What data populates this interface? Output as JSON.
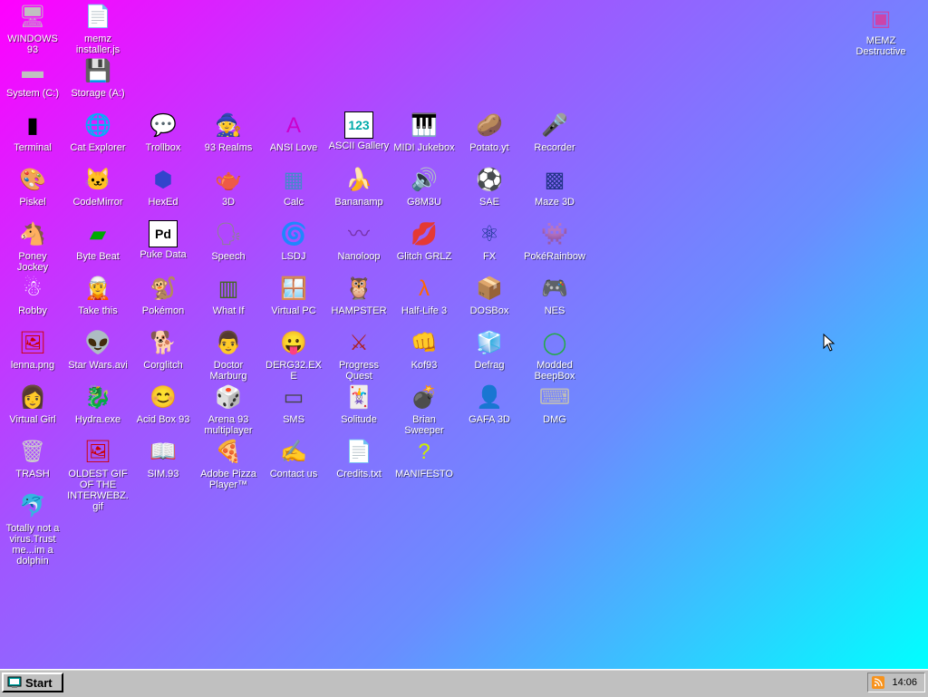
{
  "desktop": {
    "icons": [
      {
        "name": "windows93-icon-item",
        "label": "WINDOWS 93",
        "glyph": "🖥",
        "color": "#c0c0c0"
      },
      {
        "name": "memz-installer-icon-item",
        "label": "memz installer.js",
        "glyph": "📄",
        "color": "#ffd800"
      },
      {
        "name": "system-c-icon-item",
        "label": "System (C:)",
        "glyph": "▬",
        "color": "#c0c0c0"
      },
      {
        "name": "storage-a-icon-item",
        "label": "Storage (A:)",
        "glyph": "💾",
        "color": "#c0c0c0"
      },
      {
        "name": "terminal-icon-item",
        "label": "Terminal",
        "glyph": "▮",
        "color": "#000000"
      },
      {
        "name": "cat-explorer-icon-item",
        "label": "Cat Explorer",
        "glyph": "🌐",
        "color": "#3399ff"
      },
      {
        "name": "trollbox-icon-item",
        "label": "Trollbox",
        "glyph": "💬",
        "color": "#66ccff"
      },
      {
        "name": "93-realms-icon-item",
        "label": "93 Realms",
        "glyph": "🧙",
        "color": "#cc0000"
      },
      {
        "name": "ansi-love-icon-item",
        "label": "ANSI Love",
        "glyph": "A",
        "color": "#cc00cc"
      },
      {
        "name": "ascii-gallery-icon-item",
        "label": "ASCII Gallery",
        "glyph": "123",
        "color": "#00aaaa"
      },
      {
        "name": "midi-jukebox-icon-item",
        "label": "MIDI Jukebox",
        "glyph": "🎹",
        "color": "#000000"
      },
      {
        "name": "potato-yt-icon-item",
        "label": "Potato.yt",
        "glyph": "🥔",
        "color": "#a0703a"
      },
      {
        "name": "recorder-icon-item",
        "label": "Recorder",
        "glyph": "🎤",
        "color": "#888888"
      },
      {
        "name": "piskel-icon-item",
        "label": "Piskel",
        "glyph": "🎨",
        "color": "#ffcc66"
      },
      {
        "name": "codemirror-icon-item",
        "label": "CodeMirror",
        "glyph": "🐱",
        "color": "#ffffff"
      },
      {
        "name": "hexed-icon-item",
        "label": "HexEd",
        "glyph": "⬢",
        "color": "#3344cc"
      },
      {
        "name": "3d-icon-item",
        "label": "3D",
        "glyph": "🫖",
        "color": "#ff99cc"
      },
      {
        "name": "calc-icon-item",
        "label": "Calc",
        "glyph": "▦",
        "color": "#4488cc"
      },
      {
        "name": "bananamp-icon-item",
        "label": "Bananamp",
        "glyph": "🍌",
        "color": "#ffdd00"
      },
      {
        "name": "g8m3u-icon-item",
        "label": "G8M3U",
        "glyph": "🔊",
        "color": "#ffffff"
      },
      {
        "name": "sae-icon-item",
        "label": "SAE",
        "glyph": "⚽",
        "color": "#ff3355"
      },
      {
        "name": "maze3d-icon-item",
        "label": "Maze 3D",
        "glyph": "▩",
        "color": "#223388"
      },
      {
        "name": "poney-jockey-icon-item",
        "label": "Poney Jockey",
        "glyph": "🐴",
        "color": "#aa66cc"
      },
      {
        "name": "byte-beat-icon-item",
        "label": "Byte Beat",
        "glyph": "▰",
        "color": "#00aa00"
      },
      {
        "name": "puke-data-icon-item",
        "label": "Puke Data",
        "glyph": "Pd",
        "color": "#000000"
      },
      {
        "name": "speech-icon-item",
        "label": "Speech",
        "glyph": "🗣",
        "color": "#888888"
      },
      {
        "name": "lsdj-icon-item",
        "label": "LSDJ",
        "glyph": "🌀",
        "color": "#cc33cc"
      },
      {
        "name": "nanoloop-icon-item",
        "label": "Nanoloop",
        "glyph": "〰",
        "color": "#7733aa"
      },
      {
        "name": "glitch-grlz-icon-item",
        "label": "Glitch GRLZ",
        "glyph": "💋",
        "color": "#ff2244"
      },
      {
        "name": "fx-icon-item",
        "label": "FX",
        "glyph": "⚛",
        "color": "#113388"
      },
      {
        "name": "pokerainbow-icon-item",
        "label": "PokéRainbow",
        "glyph": "👾",
        "color": "#558844"
      },
      {
        "name": "robby-icon-item",
        "label": "Robby",
        "glyph": "☃",
        "color": "#ffffff"
      },
      {
        "name": "take-this-icon-item",
        "label": "Take this",
        "glyph": "🧝",
        "color": "#ff6622"
      },
      {
        "name": "pokemon-icon-item",
        "label": "Pokémon",
        "glyph": "🐒",
        "color": "#aa7733"
      },
      {
        "name": "what-if-icon-item",
        "label": "What If",
        "glyph": "▥",
        "color": "#446622"
      },
      {
        "name": "virtual-pc-icon-item",
        "label": "Virtual PC",
        "glyph": "🪟",
        "color": "#3366cc"
      },
      {
        "name": "hampster-icon-item",
        "label": "HAMPSTER",
        "glyph": "🦉",
        "color": "#888888"
      },
      {
        "name": "half-life3-icon-item",
        "label": "Half-Life 3",
        "glyph": "λ",
        "color": "#ff6600"
      },
      {
        "name": "dosbox-icon-item",
        "label": "DOSBox",
        "glyph": "📦",
        "color": "#aa7733"
      },
      {
        "name": "nes-icon-item",
        "label": "NES",
        "glyph": "🎮",
        "color": "#cccccc"
      },
      {
        "name": "lenna-icon-item",
        "label": "lenna.png",
        "glyph": "🖼",
        "color": "#cc0000"
      },
      {
        "name": "star-wars-icon-item",
        "label": "Star Wars.avi",
        "glyph": "👽",
        "color": "#66aa33"
      },
      {
        "name": "corglitch-icon-item",
        "label": "Corglitch",
        "glyph": "🐕",
        "color": "#dd8833"
      },
      {
        "name": "doctor-marburg-icon-item",
        "label": "Doctor Marburg",
        "glyph": "👨",
        "color": "#cc3333"
      },
      {
        "name": "derg32-icon-item",
        "label": "DERG32.EXE",
        "glyph": "😛",
        "color": "#ffffff"
      },
      {
        "name": "progress-quest-icon-item",
        "label": "Progress Quest",
        "glyph": "⚔",
        "color": "#aa2222"
      },
      {
        "name": "kof93-icon-item",
        "label": "Kof93",
        "glyph": "👊",
        "color": "#cc6633"
      },
      {
        "name": "defrag-icon-item",
        "label": "Defrag",
        "glyph": "🧊",
        "color": "#66cc33"
      },
      {
        "name": "modded-beepbox-icon-item",
        "label": "Modded BeepBox",
        "glyph": "◯",
        "color": "#22aa44"
      },
      {
        "name": "virtual-girl-icon-item",
        "label": "Virtual Girl",
        "glyph": "👩",
        "color": "#ffccaa"
      },
      {
        "name": "hydra-icon-item",
        "label": "Hydra.exe",
        "glyph": "🐉",
        "color": "#228833"
      },
      {
        "name": "acid-box-icon-item",
        "label": "Acid Box 93",
        "glyph": "😊",
        "color": "#ffee00"
      },
      {
        "name": "arena93-icon-item",
        "label": "Arena 93 multiplayer",
        "glyph": "🎲",
        "color": "#44aacc"
      },
      {
        "name": "sms-icon-item",
        "label": "SMS",
        "glyph": "▭",
        "color": "#444444"
      },
      {
        "name": "solitude-icon-item",
        "label": "Solitude",
        "glyph": "🃏",
        "color": "#3366cc"
      },
      {
        "name": "brian-sweeper-icon-item",
        "label": "Brian Sweeper",
        "glyph": "💣",
        "color": "#444444"
      },
      {
        "name": "gafa3d-icon-item",
        "label": "GAFA 3D",
        "glyph": "👤",
        "color": "#cc7744"
      },
      {
        "name": "dmg-icon-item",
        "label": "DMG",
        "glyph": "⌨",
        "color": "#bbbbbb"
      },
      {
        "name": "trash-icon-item",
        "label": "TRASH",
        "glyph": "🗑",
        "color": "#cccccc"
      },
      {
        "name": "oldest-gif-icon-item",
        "label": "OLDEST GIF OF THE INTERWEBZ.gif",
        "glyph": "🖼",
        "color": "#cc0000"
      },
      {
        "name": "sim93-icon-item",
        "label": "SIM.93",
        "glyph": "📖",
        "color": "#ffffff"
      },
      {
        "name": "adobe-pizza-icon-item",
        "label": "Adobe Pizza Player™",
        "glyph": "🍕",
        "color": "#ff8833"
      },
      {
        "name": "contact-us-icon-item",
        "label": "Contact us",
        "glyph": "✍",
        "color": "#ffffff"
      },
      {
        "name": "credits-icon-item",
        "label": "Credits.txt",
        "glyph": "📄",
        "color": "#ffffff"
      },
      {
        "name": "manifesto-icon-item",
        "label": "MANIFESTO",
        "glyph": "?",
        "color": "#ccee00"
      },
      {
        "name": "dolphin-icon-item",
        "label": "Totally not a virus.Trust me...im a dolphin",
        "glyph": "🐬",
        "color": "#66aacc"
      },
      {
        "name": "memz-destructive-icon-item",
        "label": "MEMZ Destructive",
        "glyph": "▣",
        "color": "#cc44aa"
      }
    ]
  },
  "taskbar": {
    "start_label": "Start",
    "clock": "14:06",
    "colors": {
      "face": "#c0c0c0",
      "tray_rss": "#f7931e"
    }
  }
}
